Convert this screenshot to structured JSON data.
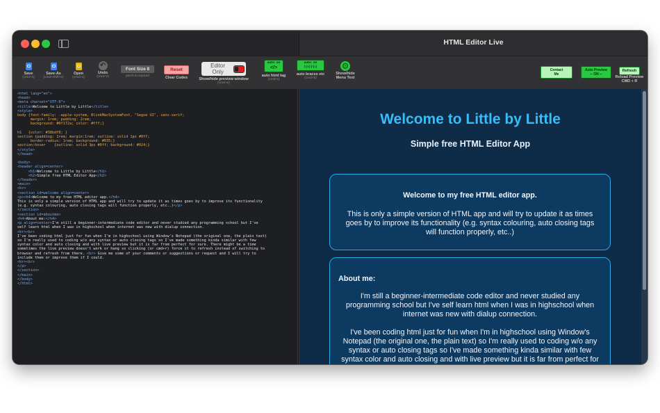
{
  "window": {
    "title": "HTML Editor Live"
  },
  "toolbar": {
    "save": {
      "label": "Save",
      "sub": "(cmd+s)"
    },
    "save_as": {
      "label": "Save-As",
      "sub": "(cmd+shift+s)"
    },
    "open": {
      "label": "Open",
      "sub": "(cmd+o)"
    },
    "undo": {
      "label": "Undo",
      "sub": "(cmd+z)"
    },
    "font_size": {
      "label": "Font Size 8",
      "sub": "pinch to expand"
    },
    "reset": {
      "label": "Reset",
      "sub": "Clear Codes"
    },
    "editor_only": {
      "label": "Editor Only",
      "sub": "Show/hide preview window",
      "sub2": "(cmd+e)"
    },
    "auto_html": {
      "top": "auto: on",
      "big": "</>",
      "sub": "auto html tag",
      "sub2": "(cmd+t)"
    },
    "auto_braces": {
      "top": "auto: on",
      "big": "(-)-[-]-{-}",
      "sub": "auto braces etc",
      "sub2": "(cmd+b)"
    },
    "menu_text": {
      "label": "Show/hide",
      "sub": "Menu Text"
    },
    "contact": {
      "label": "Contact",
      "sub": "Me"
    },
    "auto_preview": {
      "label": "Auto Preview",
      "sub": "-- ON --"
    },
    "refresh": {
      "label": "Refresh",
      "sub": "Reload Preview",
      "sub2": "CMD + R"
    }
  },
  "editor": {
    "lines": [
      "<html lang=\"en\">",
      "<head>",
      "<meta charset=\"UTF-8\">",
      "<title>Welcome to Little by Little</title>",
      "<style>",
      "body {font-family: -apple-system, BlinkMacSystemFont, \"Segoe UI\", sans-serif;",
      "      margin: 1rem; padding: 2rem;",
      "      background: #0f172a; color: #fff;}",
      "",
      "h1   {color: #38bdf8; }",
      "section {padding: 1rem; margin:1rem; outline: solid 1px #0ff;",
      "      border-radius: 1rem; background: #035;}",
      "section:hover    {outline: solid 3px #0ff; background: #024;}",
      "</style>",
      "</head>",
      "",
      "<body>",
      "<header align=center>",
      "     <h1>Welcome to Little by Little</h1>",
      "     <h2>Simple free HTML Editor App</h2>",
      "</header>",
      "<main>",
      "<br>",
      "<section id=welcome align=center>",
      "<p><h4>Welcome to my free HTML editor app.</h4>",
      "This is only a simple version of HTML app and will try to update it as times goes by to improve its functionality",
      "(e.g. syntax colouring, auto closing tags will function properly, etc..)</p>",
      "</section>",
      "<section id=aboutme>",
      "<h4>About me:</h4>",
      "<p align=center>I'm still a beginner-intermediate code editor and never studied any programming school but I've",
      "self learn html when I was in highschool when internet was new with dialup connection.",
      "<br><br>",
      "I've been coding html just for fun when I'm in highschool using Window's Notepad (the original one, the plain text)",
      "so I'm really used to coding w/o any syntax or auto closing tags so I've made something kinda similar with few",
      "syntax color and auto closing and with live preview but it is far from perfect for sure. There might be a time",
      "sometimes the live preview doesn't work or hang so clicking (or cmd+r) force it to refresh instead of switching to",
      "browser and refresh from there. <br> Give me some of your comments or suggestions or request and I will try to",
      "include them or improve them if I could.",
      "<br><br>",
      "</p>",
      "</section>",
      "</main>",
      "</body>",
      "</html>"
    ]
  },
  "preview": {
    "h1": "Welcome to Little by Little",
    "h2": "Simple free HTML Editor App",
    "welcome_title": "Welcome to my free HTML editor app.",
    "welcome_text": "This is only a simple version of HTML app and will try to update it as times goes by to improve its functionality (e.g. syntax colouring, auto closing tags will function properly, etc..)",
    "about_title": "About me:",
    "about_p1": "I'm still a beginner-intermediate code editor and never studied any programming school but I've self learn html when I was in highschool when internet was new with dialup connection.",
    "about_p2": "I've been coding html just for fun when I'm in highschool using Window's Notepad (the original one, the plain text) so I'm really used to coding w/o any syntax or auto closing tags so I've made something kinda similar with few syntax color and auto closing and with live preview but it is far from perfect for sure. There might be a time sometimes the live preview doesn't work or hang"
  },
  "colors": {
    "preview_bg": "#0e2b47",
    "heading": "#38bdf8",
    "section_border": "#2aa8e8",
    "accent_green": "#28c840"
  }
}
